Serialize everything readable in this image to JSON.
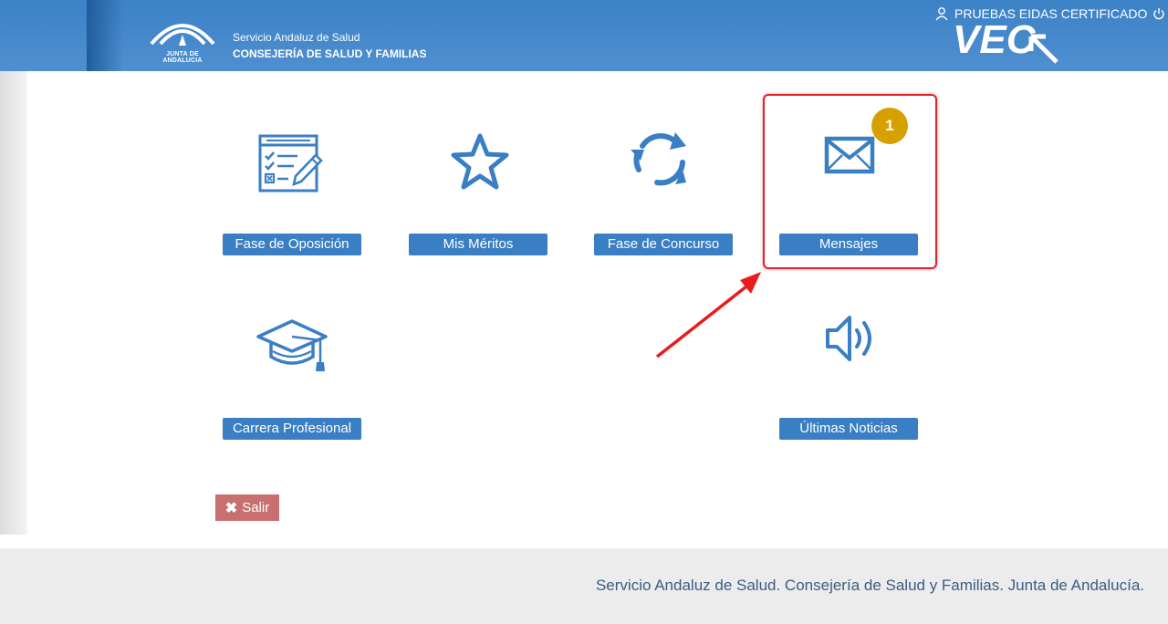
{
  "header": {
    "logo_text": "JUNTA DE ANDALUCIA",
    "org_line1": "Servicio Andaluz de Salud",
    "org_line2": "CONSEJERÍA DE SALUD Y FAMILIAS",
    "user_name": "PRUEBAS EIDAS CERTIFICADO",
    "brand": "VEC",
    "icons": [
      "user-icon",
      "power-icon"
    ]
  },
  "tiles": [
    {
      "label": "Fase de Oposición",
      "icon": "checklist-form-icon"
    },
    {
      "label": "Mis Méritos",
      "icon": "star-icon"
    },
    {
      "label": "Fase de Concurso",
      "icon": "refresh-icon"
    },
    {
      "label": "Mensajes",
      "icon": "envelope-icon",
      "badge": "1"
    },
    {
      "label": "Carrera Profesional",
      "icon": "graduation-cap-icon"
    },
    {
      "label": "Últimas Noticias",
      "icon": "speaker-icon"
    }
  ],
  "salir_label": "Salir",
  "footer_text": "Servicio Andaluz de Salud. Consejería de Salud y Familias. Junta de Andalucía.",
  "colors": {
    "header_blue": "#3b82c6",
    "icon_blue": "#3a7ec4",
    "badge_gold": "#d6a100",
    "highlight_red": "#e3232c",
    "salir_red": "#c87070",
    "footer_text": "#3c5b85"
  }
}
